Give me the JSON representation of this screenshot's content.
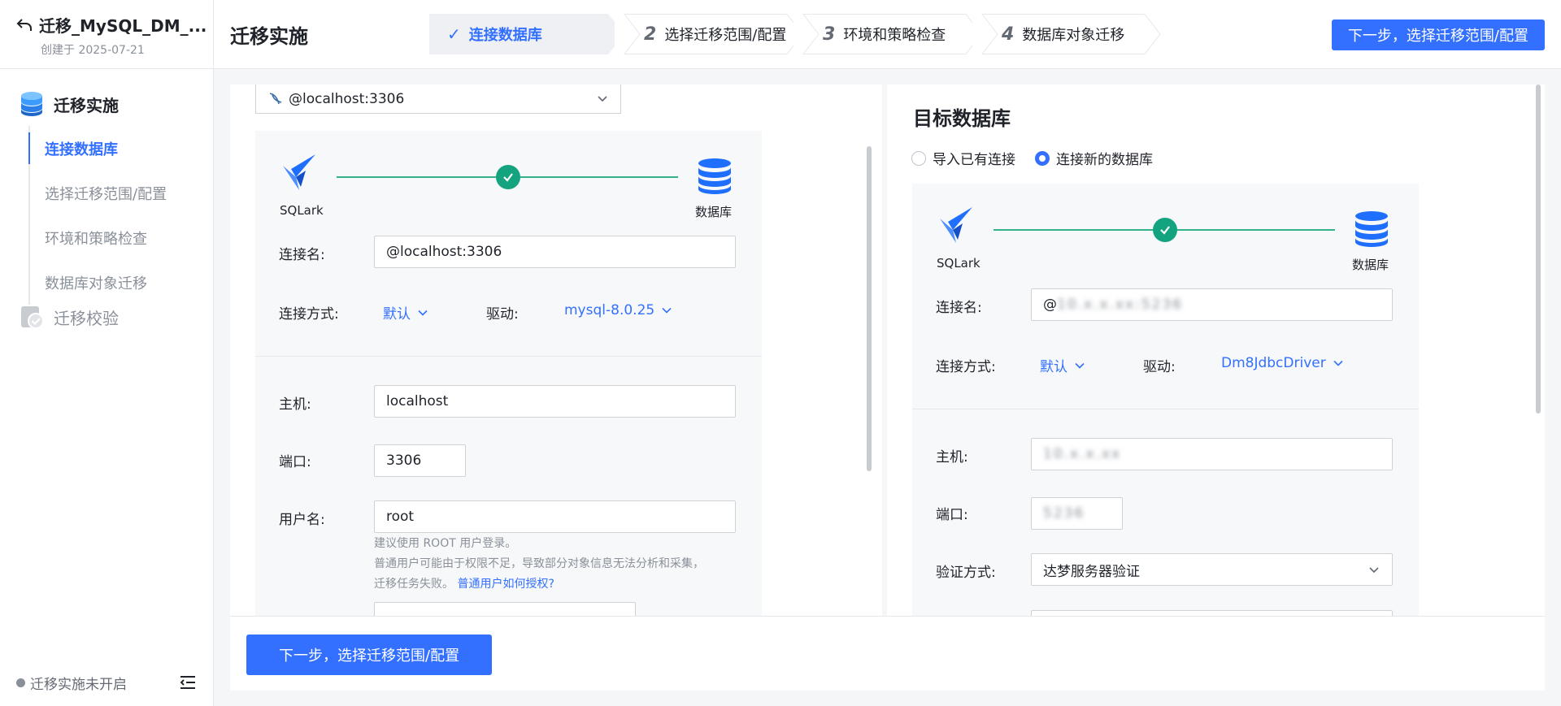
{
  "project": {
    "title": "迁移_MySQL_DM_...",
    "created": "创建于 2025-07-21"
  },
  "sidebar": {
    "group1_label": "迁移实施",
    "items": [
      {
        "label": "连接数据库"
      },
      {
        "label": "选择迁移范围/配置"
      },
      {
        "label": "环境和策略检查"
      },
      {
        "label": "数据库对象迁移"
      }
    ],
    "group2_label": "迁移校验",
    "status": "迁移实施未开启"
  },
  "header": {
    "title": "迁移实施",
    "steps": [
      {
        "num": "",
        "label": "连接数据库"
      },
      {
        "num": "2",
        "label": "选择迁移范围/配置"
      },
      {
        "num": "3",
        "label": "环境和策略检查"
      },
      {
        "num": "4",
        "label": "数据库对象迁移"
      }
    ],
    "next_button": "下一步，选择迁移范围/配置"
  },
  "source": {
    "connection_select": "@localhost:3306",
    "flow_left_label": "SQLark",
    "flow_right_label": "数据库",
    "conn_name_label": "连接名:",
    "conn_name_value": "@localhost:3306",
    "method_label": "连接方式:",
    "method_value": "默认",
    "driver_label": "驱动:",
    "driver_value": "mysql-8.0.25",
    "host_label": "主机:",
    "host_value": "localhost",
    "port_label": "端口:",
    "port_value": "3306",
    "user_label": "用户名:",
    "user_value": "root",
    "hint_line1": "建议使用 ROOT 用户登录。",
    "hint_line2": "普通用户可能由于权限不足，导致部分对象信息无法分析和采集，",
    "hint_line3": "迁移任务失败。",
    "hint_link": "普通用户如何授权?"
  },
  "target": {
    "title": "目标数据库",
    "radio_existing": "导入已有连接",
    "radio_new": "连接新的数据库",
    "flow_left_label": "SQLark",
    "flow_right_label": "数据库",
    "conn_name_label": "连接名:",
    "conn_name_value": "@",
    "conn_name_blur": "10.x.x.xx:5236",
    "method_label": "连接方式:",
    "method_value": "默认",
    "driver_label": "驱动:",
    "driver_value": "Dm8JdbcDriver",
    "host_label": "主机:",
    "host_blur": "10.x.x.xx",
    "port_label": "端口:",
    "port_blur": "5236",
    "auth_label": "验证方式:",
    "auth_value": "达梦服务器验证"
  },
  "footer": {
    "next_button": "下一步，选择迁移范围/配置"
  },
  "colors": {
    "accent": "#3370ff",
    "success": "#14a37f",
    "flow_line": "#34b38a"
  }
}
